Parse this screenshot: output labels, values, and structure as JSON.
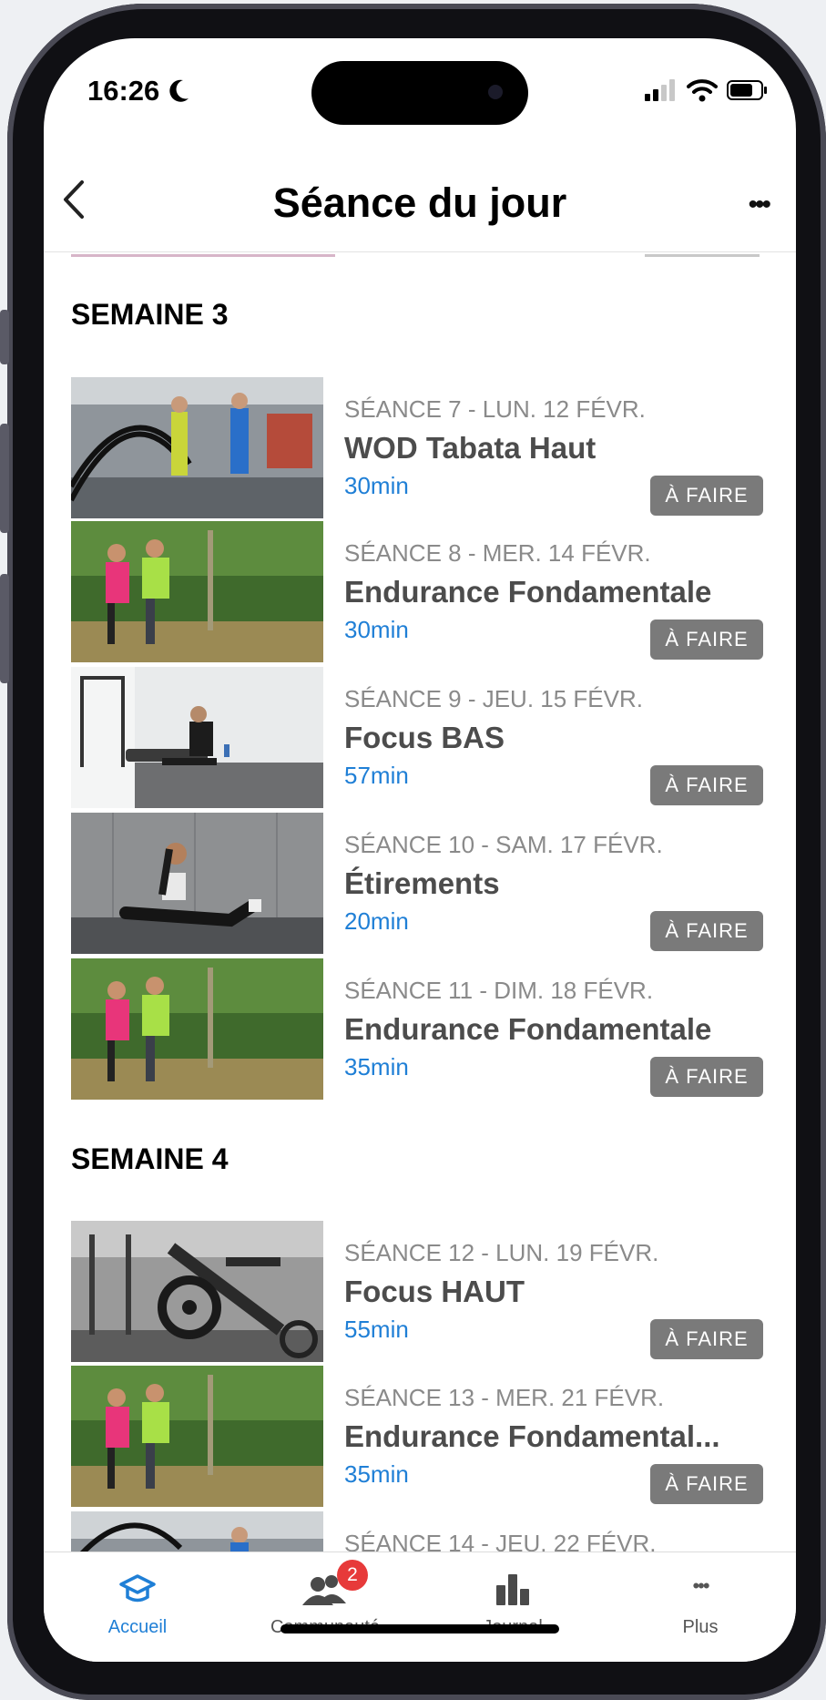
{
  "status_bar": {
    "time": "16:26"
  },
  "header": {
    "title": "Séance du jour",
    "back_icon": "chevron-left-icon",
    "more_icon": "ellipsis-icon",
    "more_label": "•••"
  },
  "weeks": [
    {
      "title": "SEMAINE 3"
    },
    {
      "title": "SEMAINE 4"
    }
  ],
  "sessions": [
    {
      "subtitle": "SÉANCE 7 - LUN. 12 FÉVR.",
      "name": "WOD Tabata Haut",
      "duration": "30min",
      "status": "À FAIRE",
      "image": "gym-battle-ropes"
    },
    {
      "subtitle": "SÉANCE 8 - MER. 14 FÉVR.",
      "name": "Endurance Fondamentale",
      "duration": "30min",
      "status": "À FAIRE",
      "image": "outdoor-runners"
    },
    {
      "subtitle": "SÉANCE 9 - JEU. 15 FÉVR.",
      "name": "Focus BAS",
      "duration": "57min",
      "status": "À FAIRE",
      "image": "home-lunge"
    },
    {
      "subtitle": "SÉANCE 10 - SAM. 17 FÉVR.",
      "name": "Étirements",
      "duration": "20min",
      "status": "À FAIRE",
      "image": "stretching-woman"
    },
    {
      "subtitle": "SÉANCE 11 - DIM. 18 FÉVR.",
      "name": "Endurance Fondamentale",
      "duration": "35min",
      "status": "À FAIRE",
      "image": "outdoor-runners"
    },
    {
      "subtitle": "SÉANCE 12 - LUN. 19 FÉVR.",
      "name": "Focus HAUT",
      "duration": "55min",
      "status": "À FAIRE",
      "image": "gym-machines-bw"
    },
    {
      "subtitle": "SÉANCE 13 - MER. 21 FÉVR.",
      "name": "Endurance Fondamental...",
      "duration": "35min",
      "status": "À FAIRE",
      "image": "outdoor-runners"
    },
    {
      "subtitle": "SÉANCE 14 - JEU. 22 FÉVR.",
      "image": "gym-battle-ropes"
    }
  ],
  "tab_bar": {
    "tabs": [
      {
        "label": "Accueil",
        "icon": "graduation-cap-icon",
        "active": true
      },
      {
        "label": "Communauté",
        "icon": "users-icon",
        "badge": "2"
      },
      {
        "label": "Journal",
        "icon": "bar-chart-icon"
      },
      {
        "label": "Plus",
        "icon": "ellipsis-icon",
        "glyph": "•••"
      }
    ]
  },
  "colors": {
    "accent": "#1f7fd6",
    "badge_bg": "#7a7a7a",
    "notification": "#e73a3a"
  }
}
